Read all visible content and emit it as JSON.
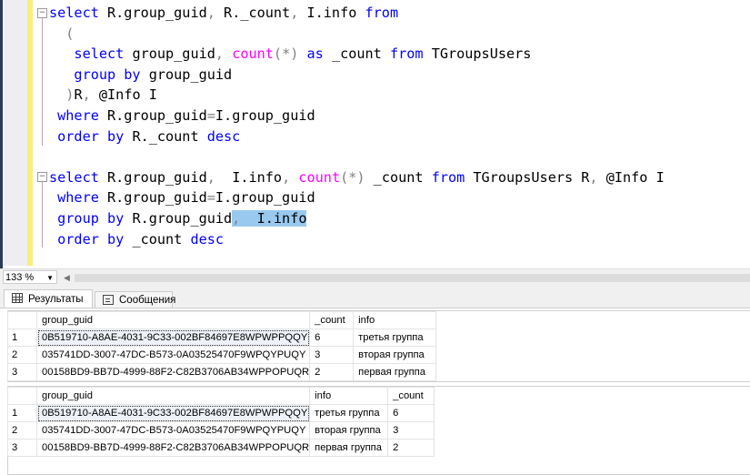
{
  "editor": {
    "lines": [
      [
        [
          "select",
          "kw"
        ],
        [
          " R.group_guid",
          "id"
        ],
        [
          ",",
          "pn"
        ],
        [
          " R._count",
          "id"
        ],
        [
          ",",
          "pn"
        ],
        [
          " I.info ",
          "id"
        ],
        [
          "from",
          "kw"
        ]
      ],
      [
        [
          "  (",
          "pn"
        ]
      ],
      [
        [
          "   select",
          "kw"
        ],
        [
          " group_guid",
          "id"
        ],
        [
          ",",
          "pn"
        ],
        [
          " ",
          "id"
        ],
        [
          "count",
          "fn"
        ],
        [
          "(*)",
          "pn"
        ],
        [
          " ",
          "id"
        ],
        [
          "as",
          "kw"
        ],
        [
          " _count ",
          "id"
        ],
        [
          "from",
          "kw"
        ],
        [
          " TGroupsUsers",
          "id"
        ]
      ],
      [
        [
          "   group by",
          "kw"
        ],
        [
          " group_guid",
          "id"
        ]
      ],
      [
        [
          "  )",
          "pn"
        ],
        [
          "R",
          "id"
        ],
        [
          ",",
          "pn"
        ],
        [
          " @Info I",
          "id"
        ]
      ],
      [
        [
          " where",
          "kw"
        ],
        [
          " R.group_guid",
          "id"
        ],
        [
          "=",
          "pn"
        ],
        [
          "I.group_guid",
          "id"
        ]
      ],
      [
        [
          " order by",
          "kw"
        ],
        [
          " R._count ",
          "id"
        ],
        [
          "desc",
          "kw"
        ]
      ],
      [],
      [
        [
          "select",
          "kw"
        ],
        [
          " R.group_guid",
          "id"
        ],
        [
          ",",
          "pn"
        ],
        [
          "  I.info",
          "id"
        ],
        [
          ",",
          "pn"
        ],
        [
          " ",
          "id"
        ],
        [
          "count",
          "fn"
        ],
        [
          "(*)",
          "pn"
        ],
        [
          " _count ",
          "id"
        ],
        [
          "from",
          "kw"
        ],
        [
          " TGroupsUsers R",
          "id"
        ],
        [
          ",",
          "pn"
        ],
        [
          " @Info I",
          "id"
        ]
      ],
      [
        [
          " where",
          "kw"
        ],
        [
          " R.group_guid",
          "id"
        ],
        [
          "=",
          "pn"
        ],
        [
          "I.group_guid",
          "id"
        ]
      ],
      [
        [
          " group by",
          "kw"
        ],
        [
          " R.group_guid",
          "id"
        ],
        [
          ",",
          "pn sel"
        ],
        [
          "  I.info",
          "id sel"
        ]
      ],
      [
        [
          " order by",
          "kw"
        ],
        [
          " _count ",
          "id"
        ],
        [
          "desc",
          "kw"
        ]
      ]
    ]
  },
  "zoom": {
    "value": "133 %"
  },
  "tabs": {
    "results": "Результаты",
    "messages": "Сообщения"
  },
  "grid1": {
    "columns": [
      "group_guid",
      "_count",
      "info"
    ],
    "rows": [
      [
        "1",
        "0B519710-A8AE-4031-9C33-002BF84697E8WPWPPQQY",
        "6",
        "третья группа"
      ],
      [
        "2",
        "035741DD-3007-47DC-B573-0A03525470F9WPQYPUQY",
        "3",
        "вторая группа"
      ],
      [
        "3",
        "00158BD9-BB7D-4999-88F2-C82B3706AB34WPPOPUQR",
        "2",
        "первая группа"
      ]
    ]
  },
  "grid2": {
    "columns": [
      "group_guid",
      "info",
      "_count"
    ],
    "rows": [
      [
        "1",
        "0B519710-A8AE-4031-9C33-002BF84697E8WPWPPQQY",
        "третья группа",
        "6"
      ],
      [
        "2",
        "035741DD-3007-47DC-B573-0A03525470F9WPQYPUQY",
        "вторая группа",
        "3"
      ],
      [
        "3",
        "00158BD9-BB7D-4999-88F2-C82B3706AB34WPPOPUQR",
        "первая группа",
        "2"
      ]
    ]
  }
}
